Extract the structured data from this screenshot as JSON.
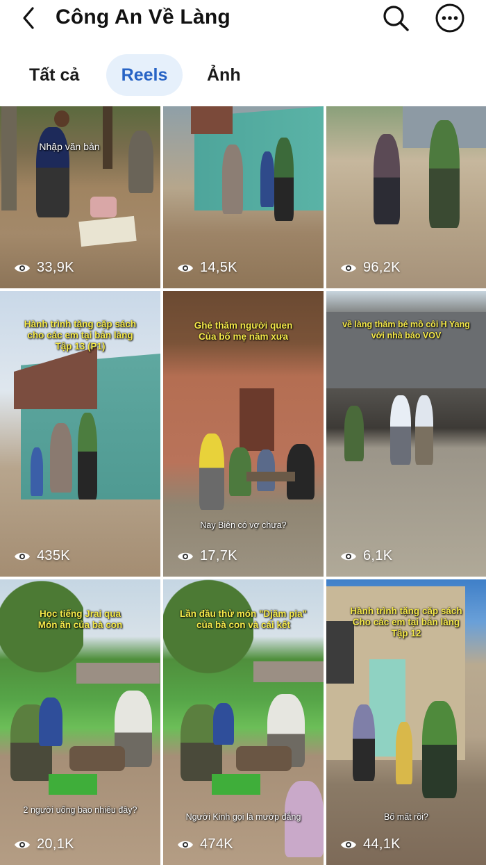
{
  "header": {
    "title": "Công An Về Làng",
    "back_icon": "chevron-left-icon",
    "search_icon": "search-icon",
    "more_icon": "more-horizontal-icon"
  },
  "tabs": [
    {
      "label": "Tất cả",
      "selected": false
    },
    {
      "label": "Reels",
      "selected": true
    },
    {
      "label": "Ảnh",
      "selected": false
    }
  ],
  "colors": {
    "accent": "#2763c5",
    "tab_selected_bg": "#e6f0fb",
    "caption_text": "#f5e94a"
  },
  "reels": [
    {
      "views": "33,9K",
      "caption": "",
      "subtitle": "",
      "overlay_text": "Nhập văn bản"
    },
    {
      "views": "14,5K",
      "caption": "",
      "subtitle": ""
    },
    {
      "views": "96,2K",
      "caption": "",
      "subtitle": ""
    },
    {
      "views": "435K",
      "caption": "Hành trình tặng cặp sách\ncho các em tại bản làng\nTập 13 (P1)",
      "subtitle": ""
    },
    {
      "views": "17,7K",
      "caption": "Ghé thăm người quen\nCủa bố mẹ năm xưa",
      "subtitle": "Nay Biên có vợ chưa?"
    },
    {
      "views": "6,1K",
      "caption": "về làng thăm bé mồ côi H Yang\nvới nhà báo VOV",
      "subtitle": ""
    },
    {
      "views": "20,1K",
      "caption": "Học tiếng Jrai qua\nMón ăn của bà con",
      "subtitle": "2 người uống bao nhiêu đây?"
    },
    {
      "views": "474K",
      "caption": "Lần đầu thử món \"Djăm pia\"\ncủa bà con và cái kết",
      "subtitle": "Người Kinh gọi là mướp đắng"
    },
    {
      "views": "44,1K",
      "caption": "Hành trình tặng cặp sách\nCho các em tại bản làng\nTập 12",
      "subtitle": "Bố mất rồi?"
    }
  ]
}
